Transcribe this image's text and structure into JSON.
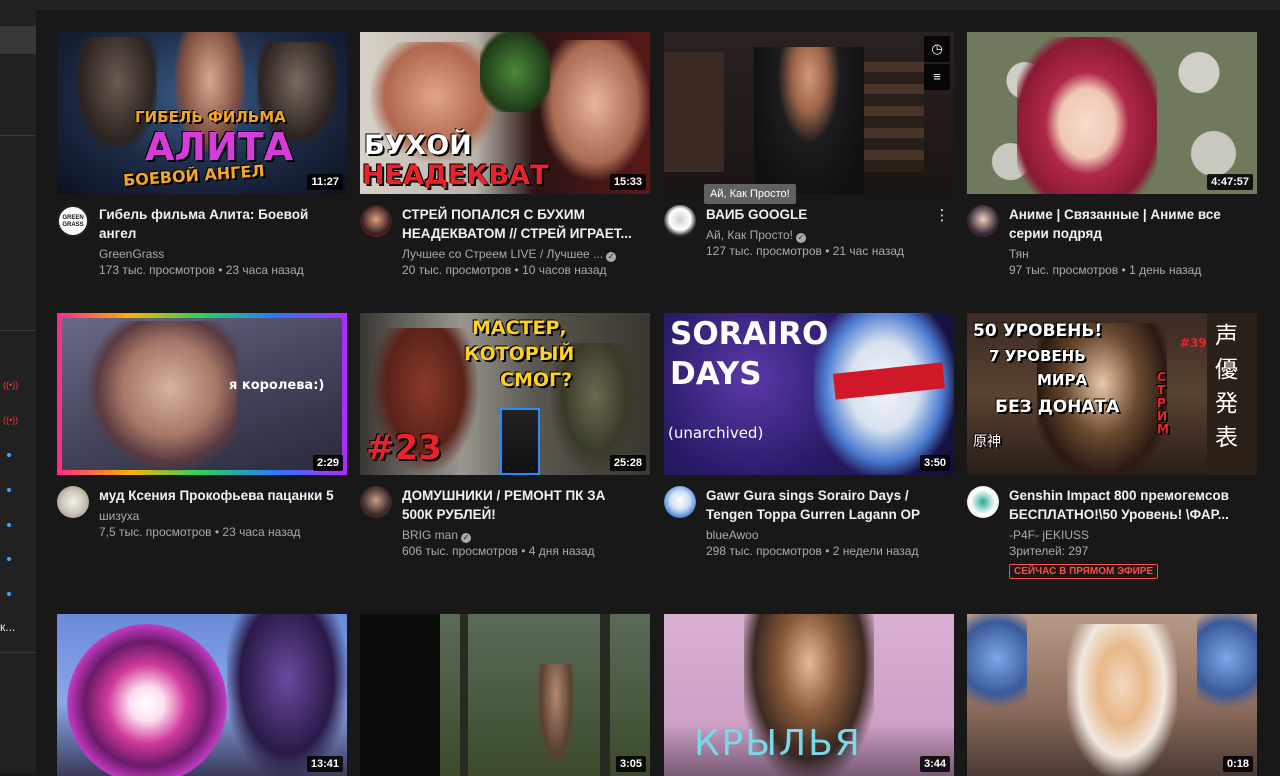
{
  "sidebar": {
    "truncated_label": "к..."
  },
  "videos": [
    {
      "thumb_text": [
        "ГИБЕЛЬ ФИЛЬМА",
        "АЛИТА",
        "БОЕВОЙ АНГЕЛ"
      ],
      "duration": "11:27",
      "title": "Гибель фильма Алита: Боевой ангел",
      "channel": "GreenGrass",
      "verified": false,
      "views": "173 тыс. просмотров",
      "age": "23 часа назад",
      "avatar_text": "GREEN GRASS"
    },
    {
      "thumb_text": [
        "БУХОЙ",
        "НЕАДЕКВАТ"
      ],
      "duration": "15:33",
      "title": "СТРЕЙ ПОПАЛСЯ С БУХИМ НЕАДЕКВАТОМ // СТРЕЙ ИГРАЕТ...",
      "channel": "Лучшее со Стреем LIVE / Лучшее ...",
      "verified": true,
      "views": "20 тыс. просмотров",
      "age": "10 часов назад",
      "avatar_text": ""
    },
    {
      "thumb_text": [],
      "duration": "",
      "title": "ВАИБ GOOGLE",
      "channel": "Ай, Как Просто!",
      "verified": true,
      "views": "127 тыс. просмотров",
      "age": "21 час назад",
      "tooltip": "Ай, Как Просто!",
      "avatar_text": ""
    },
    {
      "thumb_text": [],
      "duration": "4:47:57",
      "title": "Аниме | Связанные | Аниме все серии подряд",
      "channel": "Тян",
      "verified": false,
      "views": "97 тыс. просмотров",
      "age": "1 день назад",
      "avatar_text": ""
    },
    {
      "thumb_text": [
        "я королева:)"
      ],
      "duration": "2:29",
      "title": "муд Ксения Прокофьева пацанки 5",
      "channel": "шизуха",
      "verified": false,
      "views": "7,5 тыс. просмотров",
      "age": "23 часа назад",
      "avatar_text": ""
    },
    {
      "thumb_text": [
        "МАСТЕР,",
        "КОТОРЫЙ",
        "СМОГ?",
        "#23"
      ],
      "duration": "25:28",
      "title": "ДОМУШНИКИ / РЕМОНТ ПК ЗА 500К РУБЛЕЙ!",
      "channel": "BRIG man",
      "verified": true,
      "views": "606 тыс. просмотров",
      "age": "4 дня назад",
      "avatar_text": ""
    },
    {
      "thumb_text": [
        "SORAIRO",
        "DAYS",
        "(unarchived)"
      ],
      "duration": "3:50",
      "title": "Gawr Gura sings Sorairo Days / Tengen Toppa Gurren Lagann OP",
      "channel": "blueAwoo",
      "verified": false,
      "views": "298 тыс. просмотров",
      "age": "2 недели назад",
      "avatar_text": ""
    },
    {
      "thumb_text": [
        "50 УРОВЕНЬ!",
        "7 УРОВЕНЬ",
        "МИРА",
        "БЕЗ ДОНАТА",
        "#39",
        "СТРИМ",
        "声優発表",
        "原神"
      ],
      "duration": "",
      "title": "Genshin Impact 800 премогемсов БЕСПЛАТНО!\\50 Уровень! \\ФАР...",
      "channel": "-P4F- jEKIUSS",
      "verified": false,
      "views": "Зрителей: 297",
      "age": "",
      "live_label": "СЕЙЧАС В ПРЯМОМ ЭФИРЕ",
      "avatar_text": ""
    },
    {
      "thumb_text": [],
      "duration": "13:41"
    },
    {
      "thumb_text": [],
      "duration": "3:05"
    },
    {
      "thumb_text": [
        "КРЫЛЬЯ"
      ],
      "duration": "3:44"
    },
    {
      "thumb_text": [],
      "duration": "0:18"
    }
  ],
  "colors": {
    "background": "#181818",
    "sidebar": "#212121",
    "live_red": "#ff4e45",
    "meta_gray": "#aaaaaa"
  },
  "icons": {
    "watch_later": "clock-icon",
    "add_to_queue": "queue-icon",
    "more": "more-vert-icon",
    "verified": "check-icon",
    "live": "live-broadcast-icon"
  }
}
